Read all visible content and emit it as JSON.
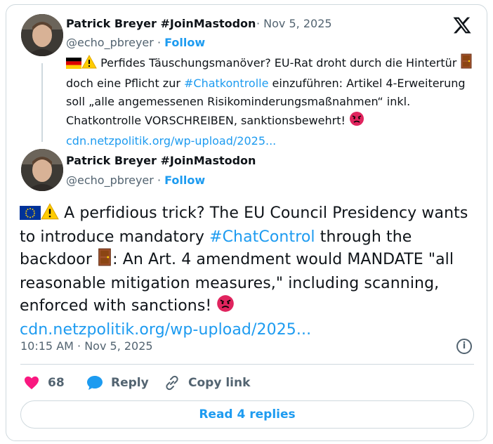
{
  "quoted": {
    "author_name": "Patrick Breyer #JoinMastodon",
    "date": "· Nov 5, 2025",
    "handle": "@echo_pbreyer",
    "separator": "·",
    "follow_label": "Follow",
    "text_1": " Perfides Täuschungsmanöver? EU-Rat droht durch die Hintertür",
    "text_2": " doch eine Pflicht zur ",
    "hashtag": "#Chatkontrolle",
    "text_3": " einzuführen: Artikel 4-Erweiterung soll „alle angemessenen Risikominderungsmaßnahmen“ inkl. Chatkontrolle VORSCHREIBEN, sanktionsbewehrt! ",
    "link": "cdn.netzpolitik.org/wp-upload/2025..."
  },
  "main": {
    "author_name": "Patrick Breyer #JoinMastodon",
    "handle": "@echo_pbreyer",
    "separator": "·",
    "follow_label": "Follow",
    "text_1": " A perfidious trick? The EU Council Presidency wants to introduce mandatory ",
    "hashtag": "#ChatControl",
    "text_2": " through the backdoor ",
    "text_3": ": An Art. 4 amendment would MANDATE \"all reasonable mitigation measures,\" including scanning, enforced with sanctions! ",
    "link": "cdn.netzpolitik.org/wp-upload/2025...",
    "timestamp": "10:15 AM · Nov 5, 2025"
  },
  "actions": {
    "like_count": "68",
    "reply_label": "Reply",
    "copy_link_label": "Copy link",
    "read_replies_label": "Read 4 replies"
  },
  "colors": {
    "accent": "#1d9bf0",
    "like": "#f91880",
    "muted": "#536471",
    "border": "#cfd9de"
  },
  "icons": [
    "x-logo-icon",
    "info-icon",
    "heart-icon",
    "reply-bubble-icon",
    "link-icon",
    "german-flag-icon",
    "eu-flag-icon",
    "warning-icon",
    "door-icon",
    "angry-face-icon"
  ]
}
